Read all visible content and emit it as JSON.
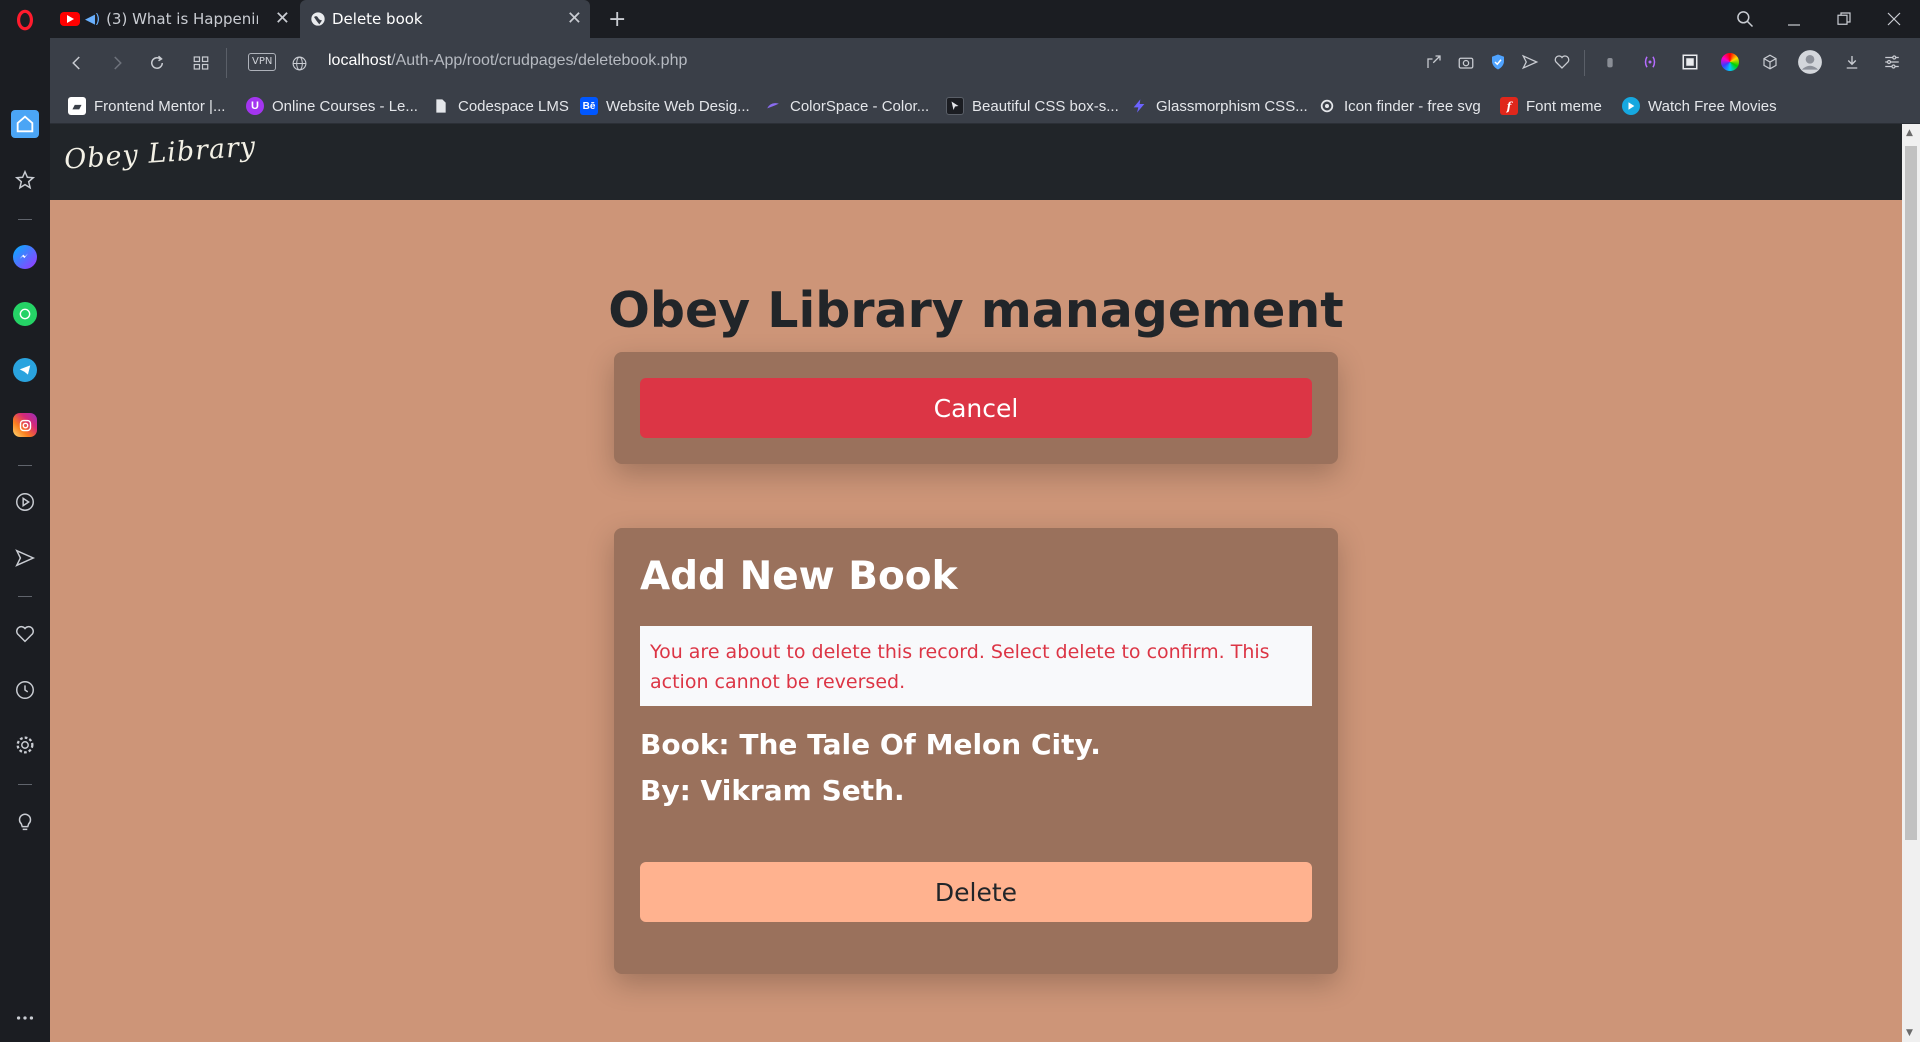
{
  "browser": {
    "tabs": [
      {
        "label": "(3) What is Happening ",
        "active": false
      },
      {
        "label": "Delete book",
        "active": true
      }
    ],
    "url_host": "localhost",
    "url_path": "/Auth-App/root/crudpages/deletebook.php",
    "vpn_label": "VPN",
    "bookmarks": [
      {
        "label": "Frontend Mentor |...",
        "icon": "frontend-mentor-icon",
        "color": "#ffffff"
      },
      {
        "label": "Online Courses - Le...",
        "icon": "udemy-icon",
        "color": "#a435f0"
      },
      {
        "label": "Codespace LMS",
        "icon": "document-icon",
        "color": "#e4e6ea"
      },
      {
        "label": "Website Web Desig...",
        "icon": "behance-icon",
        "color": "#0057ff"
      },
      {
        "label": "ColorSpace - Color...",
        "icon": "colorspace-icon",
        "color": "#8a6cf0"
      },
      {
        "label": "Beautiful CSS box-s...",
        "icon": "cursor-icon",
        "color": "#1b1d22"
      },
      {
        "label": "Glassmorphism CSS...",
        "icon": "bolt-icon",
        "color": "#6c63ff"
      },
      {
        "label": "Icon finder - free svg",
        "icon": "icon-finder-icon",
        "color": "#e4e6ea"
      },
      {
        "label": "Font meme",
        "icon": "font-meme-icon",
        "color": "#e0271b"
      },
      {
        "label": "Watch Free Movies",
        "icon": "play-icon",
        "color": "#16a8e0"
      }
    ]
  },
  "site": {
    "logo": "Obey Library",
    "title": "Obey Library management",
    "cancel_label": "Cancel",
    "card_heading": "Add New Book",
    "warning": "You are about to delete this record. Select delete to confirm. This action cannot be reversed.",
    "book_line": "Book: The Tale Of Melon City.",
    "author_line": "By: Vikram Seth.",
    "delete_label": "Delete"
  },
  "colors": {
    "page_bg": "#cd9578",
    "card_bg": "#9a715c",
    "cancel": "#dc3545",
    "delete": "#ffb28f",
    "nav": "#212529"
  }
}
